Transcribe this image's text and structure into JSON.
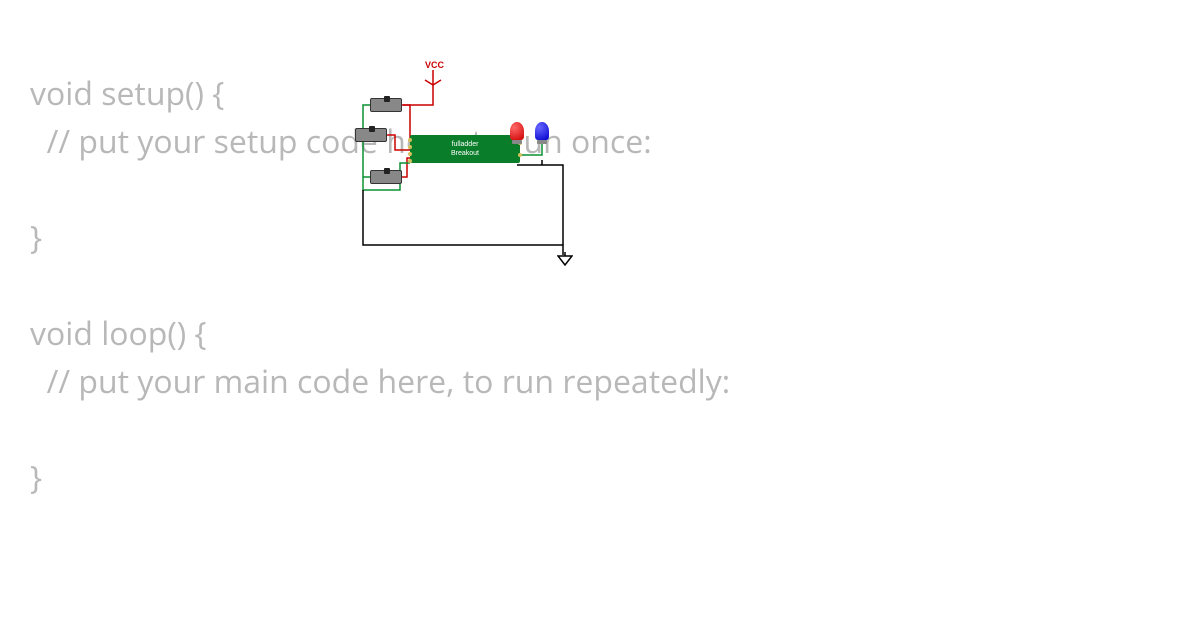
{
  "code": {
    "line1": "void setup() {",
    "line2": "  // put your setup code here, to run once:",
    "line3": "",
    "line4": "}",
    "line5": "",
    "line6": "void loop() {",
    "line7": "  // put your main code here, to run repeatedly:",
    "line8": "",
    "line9": "}"
  },
  "circuit": {
    "vcc_label": "VCC",
    "chip_line1": "fulladder",
    "chip_line2": "Breakout"
  },
  "colors": {
    "wire_red": "#cc0000",
    "wire_green": "#0a9030",
    "wire_black": "#000000",
    "chip_green": "#0a7d2a"
  }
}
